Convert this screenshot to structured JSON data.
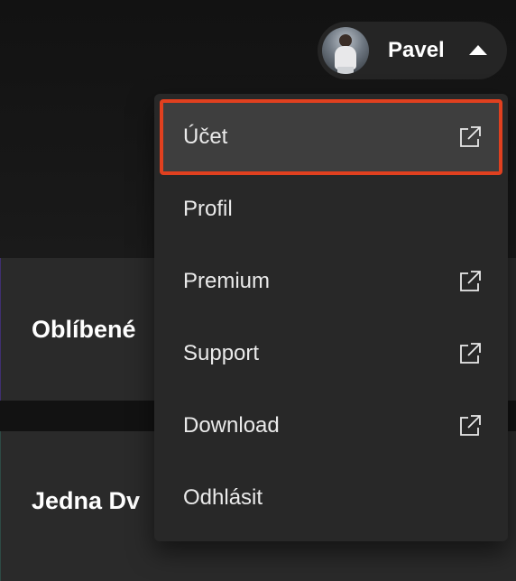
{
  "background": {
    "cards": [
      {
        "title": "Oblíbené"
      },
      {
        "title": "Jedna Dv"
      }
    ]
  },
  "user": {
    "name": "Pavel",
    "avatar_icon": "user-photo",
    "caret_icon": "caret-up-icon"
  },
  "menu": {
    "items": [
      {
        "label": "Účet",
        "external": true,
        "active": true
      },
      {
        "label": "Profil",
        "external": false,
        "active": false
      },
      {
        "label": "Premium",
        "external": true,
        "active": false
      },
      {
        "label": "Support",
        "external": true,
        "active": false
      },
      {
        "label": "Download",
        "external": true,
        "active": false
      },
      {
        "label": "Odhlásit",
        "external": false,
        "active": false
      }
    ]
  },
  "colors": {
    "highlight_outline": "#e0401f",
    "menu_bg": "#282828",
    "active_bg": "#3e3e3e"
  }
}
